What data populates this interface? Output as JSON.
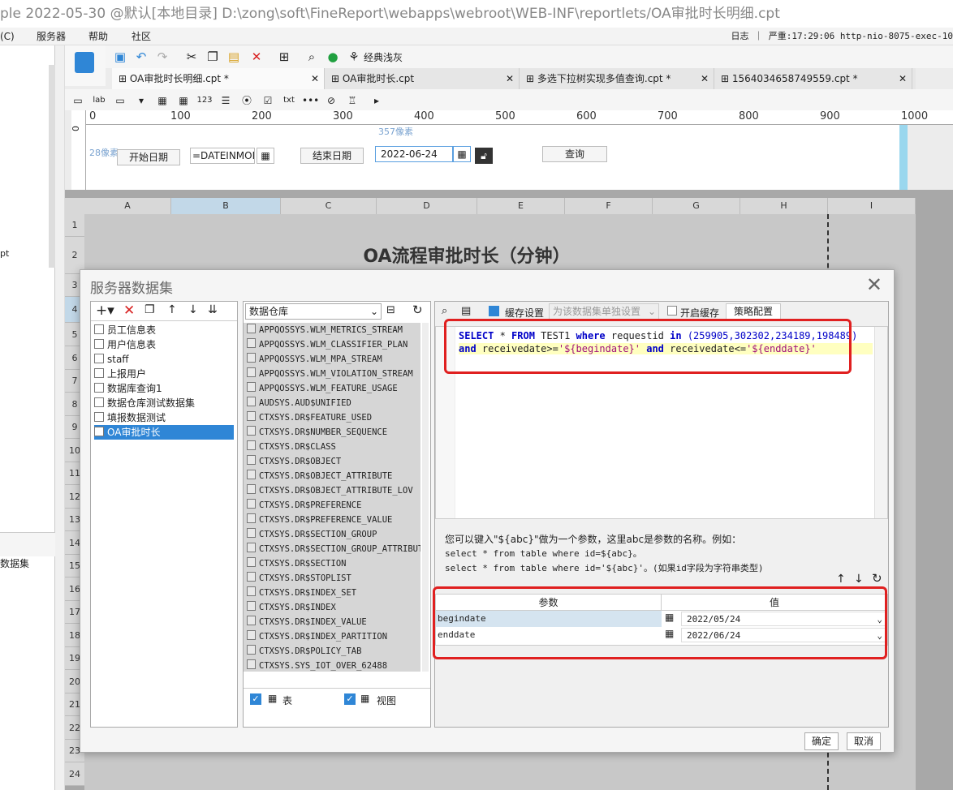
{
  "titlebar": {
    "text": "ple 2022-05-30 @默认[本地目录]     D:\\zong\\soft\\FineReport\\webapps\\webroot\\WEB-INF\\reportlets/OA审批时长明细.cpt"
  },
  "menubar": {
    "items": [
      "(C)",
      "服务器",
      "帮助",
      "社区"
    ],
    "status": "日志 ｜ 严重:17:29:06 http-nio-8075-exec-10"
  },
  "leftpanel": {
    "items": [
      "pt",
      "数据集"
    ]
  },
  "toolbar": {
    "theme_label": "经典浅灰"
  },
  "tabs": [
    {
      "label": "OA审批时长明细.cpt *"
    },
    {
      "label": "OA审批时长.cpt"
    },
    {
      "label": "多选下拉树实现多值查询.cpt *"
    },
    {
      "label": "1564034658749559.cpt *"
    }
  ],
  "ruler": {
    "ticks": [
      "0",
      "100",
      "200",
      "300",
      "400",
      "500",
      "600",
      "700",
      "800",
      "900",
      "1000"
    ],
    "left_tick": "0"
  },
  "param_form": {
    "pos_label": "357像素",
    "height_label": "28像素",
    "start_label": "开始日期",
    "start_value": "=DATEINMON",
    "end_label": "结束日期",
    "end_value": "2022-06-24",
    "query_button": "查询"
  },
  "grid": {
    "columns": [
      "A",
      "B",
      "C",
      "D",
      "E",
      "F",
      "G",
      "H",
      "I"
    ],
    "rows": [
      "1",
      "2",
      "3",
      "4",
      "5",
      "6",
      "7",
      "8",
      "9",
      "10",
      "11",
      "12",
      "13",
      "14",
      "15",
      "16",
      "17",
      "18",
      "19",
      "20",
      "21",
      "22",
      "23",
      "24"
    ],
    "title": "OA流程审批时长（分钟）"
  },
  "dialog": {
    "title": "服务器数据集",
    "datasets": [
      "员工信息表",
      "用户信息表",
      "staff",
      "上报用户",
      "数据库查询1",
      "数据仓库测试数据集",
      "填报数据测试",
      "OA审批时长"
    ],
    "db_select": "数据仓库",
    "tables": [
      "APPQOSSYS.WLM_METRICS_STREAM",
      "APPQOSSYS.WLM_CLASSIFIER_PLAN",
      "APPQOSSYS.WLM_MPA_STREAM",
      "APPQOSSYS.WLM_VIOLATION_STREAM",
      "APPQOSSYS.WLM_FEATURE_USAGE",
      "AUDSYS.AUD$UNIFIED",
      "CTXSYS.DR$FEATURE_USED",
      "CTXSYS.DR$NUMBER_SEQUENCE",
      "CTXSYS.DR$CLASS",
      "CTXSYS.DR$OBJECT",
      "CTXSYS.DR$OBJECT_ATTRIBUTE",
      "CTXSYS.DR$OBJECT_ATTRIBUTE_LOV",
      "CTXSYS.DR$PREFERENCE",
      "CTXSYS.DR$PREFERENCE_VALUE",
      "CTXSYS.DR$SECTION_GROUP",
      "CTXSYS.DR$SECTION_GROUP_ATTRIBUTE",
      "CTXSYS.DR$SECTION",
      "CTXSYS.DR$STOPLIST",
      "CTXSYS.DR$INDEX_SET",
      "CTXSYS.DR$INDEX",
      "CTXSYS.DR$INDEX_VALUE",
      "CTXSYS.DR$INDEX_PARTITION",
      "CTXSYS.DR$POLICY_TAB",
      "CTXSYS.SYS_IOT_OVER_62488"
    ],
    "check_table": "表",
    "check_view": "视图",
    "cache_label": "缓存设置",
    "cache_select": "为该数据集单独设置",
    "open_cache": "开启缓存",
    "strategy": "策略配置",
    "sql": {
      "l1_kw1": "SELECT",
      "l1_star": " * ",
      "l1_kw2": "FROM",
      "l1_t": " TEST1 ",
      "l1_kw3": "where",
      "l1_c": " requestid ",
      "l1_kw4": "in",
      "l1_nums": " (259905,302302,234189,198489)",
      "l2_kw1": "and",
      "l2_c1": " receivedate>=",
      "l2_s1": "'${begindate}'",
      "l2_sp": " ",
      "l2_kw2": "and",
      "l2_c2": " receivedate<=",
      "l2_s2": "'${enddate}'"
    },
    "hint": [
      "您可以键入\"${abc}\"做为一个参数，这里abc是参数的名称。例如：",
      "select * from table where id=${abc}。",
      "select * from table where id='${abc}'。(如果id字段为字符串类型)"
    ],
    "param_header": "参数",
    "value_header": "值",
    "params": [
      {
        "name": "begindate",
        "value": "2022/05/24"
      },
      {
        "name": "enddate",
        "value": "2022/06/24"
      }
    ],
    "ok": "确定",
    "cancel": "取消"
  }
}
